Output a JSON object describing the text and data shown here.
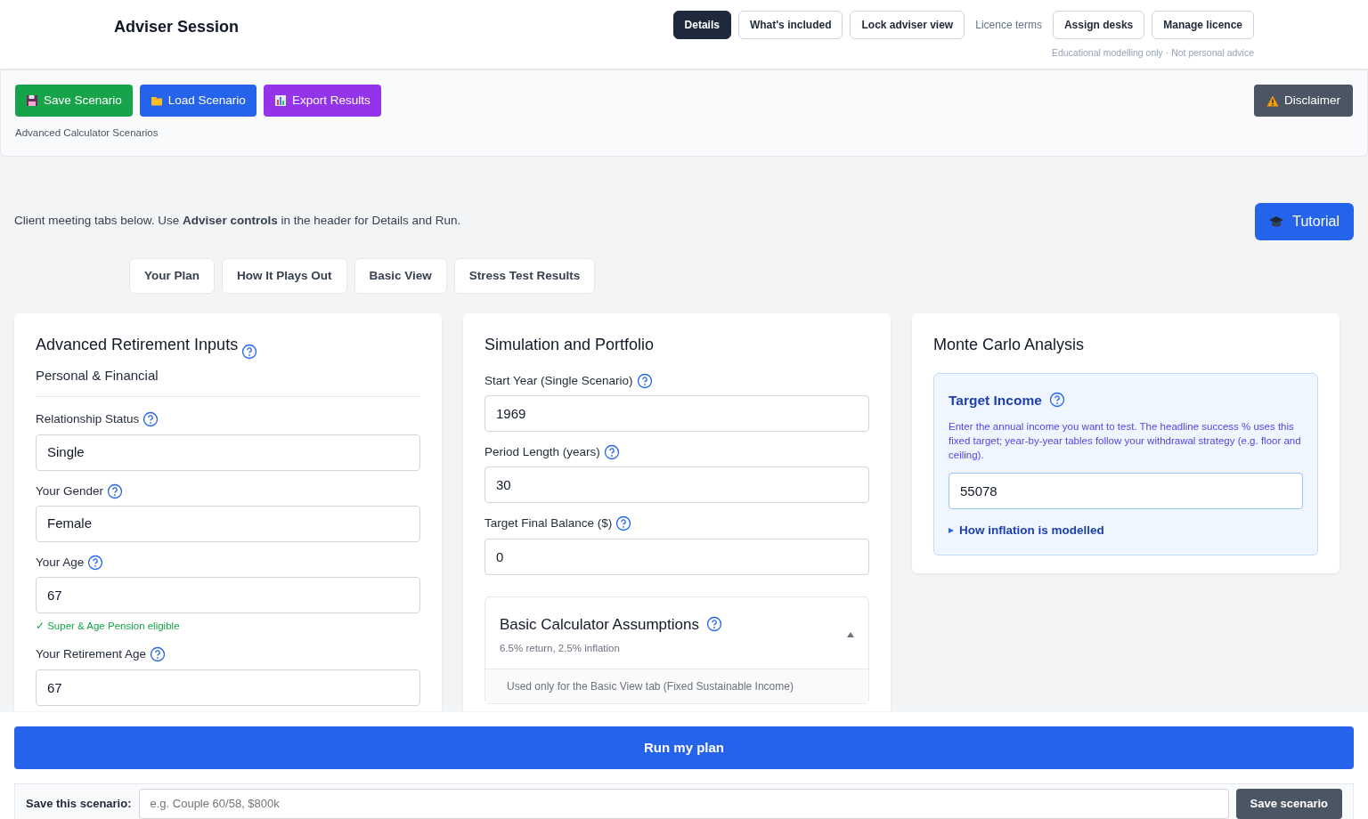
{
  "header": {
    "title": "Adviser Session",
    "nav": [
      {
        "label": "Details",
        "kind": "button",
        "selected": true
      },
      {
        "label": "What's included",
        "kind": "button",
        "selected": false
      },
      {
        "label": "Lock adviser view",
        "kind": "button",
        "selected": false
      },
      {
        "label": "Licence terms",
        "kind": "link",
        "selected": false
      },
      {
        "label": "Assign desks",
        "kind": "button",
        "selected": false
      },
      {
        "label": "Manage licence",
        "kind": "button",
        "selected": false
      }
    ],
    "note": "Educational modelling only · Not personal advice"
  },
  "toolbar": {
    "buttons": [
      {
        "label": "Save Scenario",
        "kind": "save"
      },
      {
        "label": "Load Scenario",
        "kind": "load"
      },
      {
        "label": "Export Results",
        "kind": "export"
      }
    ],
    "caption": "Advanced Calculator Scenarios",
    "disclaimer": "Disclaimer"
  },
  "intro": "Client meeting tabs below. Use **Adviser controls** in the header for Details and Run.",
  "tutorial": "Tutorial",
  "tabs": [
    {
      "label": "Your Plan",
      "selected": false
    },
    {
      "label": "How It Plays Out",
      "selected": false
    },
    {
      "label": "Basic View",
      "selected": false
    },
    {
      "label": "Stress Test Results",
      "selected": false
    }
  ],
  "inputs_card": {
    "title": "Advanced Retirement Inputs",
    "section": "Personal & Financial",
    "fields": [
      {
        "label": "Relationship Status",
        "kind": "select",
        "value": "Single"
      },
      {
        "label": "Your Gender",
        "kind": "select",
        "value": "Female"
      },
      {
        "label": "Your Age",
        "kind": "input",
        "value": "67",
        "note": "✓ Super & Age Pension eligible"
      },
      {
        "label": "Your Retirement Age",
        "kind": "input",
        "value": "67"
      }
    ]
  },
  "simulation_card": {
    "title": "Simulation and Portfolio",
    "fields": [
      {
        "label": "Start Year (Single Scenario)",
        "kind": "input",
        "value": "1969"
      },
      {
        "label": "Period Length (years)",
        "kind": "input",
        "value": "30"
      },
      {
        "label": "Target Final Balance ($)",
        "kind": "input",
        "value": "0"
      }
    ],
    "assumptions": {
      "title": "Basic Calculator Assumptions",
      "subtitle": "6.5% return, 2.5% inflation",
      "expanded": true,
      "body": "Used only for the Basic View tab (Fixed Sustainable Income)"
    }
  },
  "monte_carlo_card": {
    "title": "Monte Carlo Analysis",
    "target": {
      "title": "Target Income",
      "help": "Enter the annual income you want to test. The headline success % uses this fixed target; year-by-year tables follow your withdrawal strategy (e.g. floor and ceiling).",
      "value": "55078",
      "details": {
        "label": "How inflation is modelled",
        "expanded": false
      }
    }
  },
  "run_button": "Run my plan",
  "save_row": {
    "label": "Save this scenario:",
    "placeholder": "e.g. Couple 60/58, $800k",
    "button": "Save scenario"
  }
}
